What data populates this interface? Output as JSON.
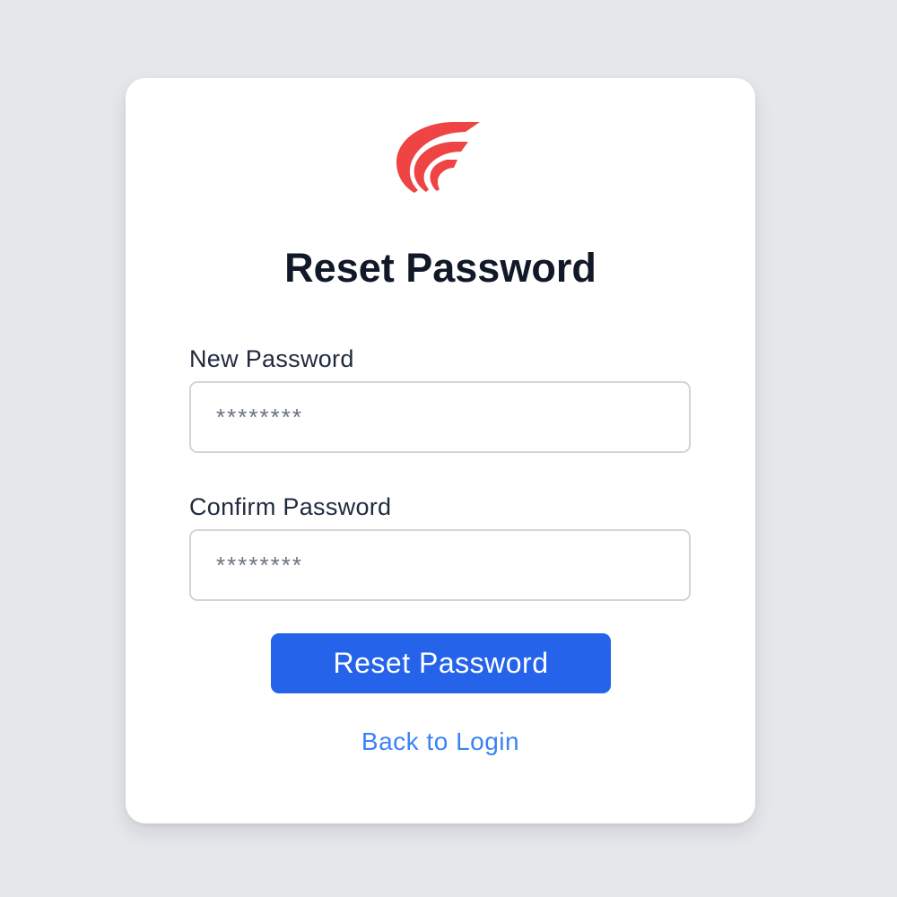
{
  "brand": {
    "logo_icon": "brand-swoosh-logo",
    "logo_color": "#ef4444"
  },
  "page": {
    "title": "Reset Password"
  },
  "form": {
    "new_password": {
      "label": "New Password",
      "placeholder": "********"
    },
    "confirm_password": {
      "label": "Confirm Password",
      "placeholder": "********"
    },
    "submit_label": "Reset Password",
    "back_link_label": "Back to Login"
  },
  "colors": {
    "background": "#e5e7eb",
    "card": "#ffffff",
    "primary": "#2563eb",
    "link": "#3b82f6",
    "heading": "#111827"
  }
}
